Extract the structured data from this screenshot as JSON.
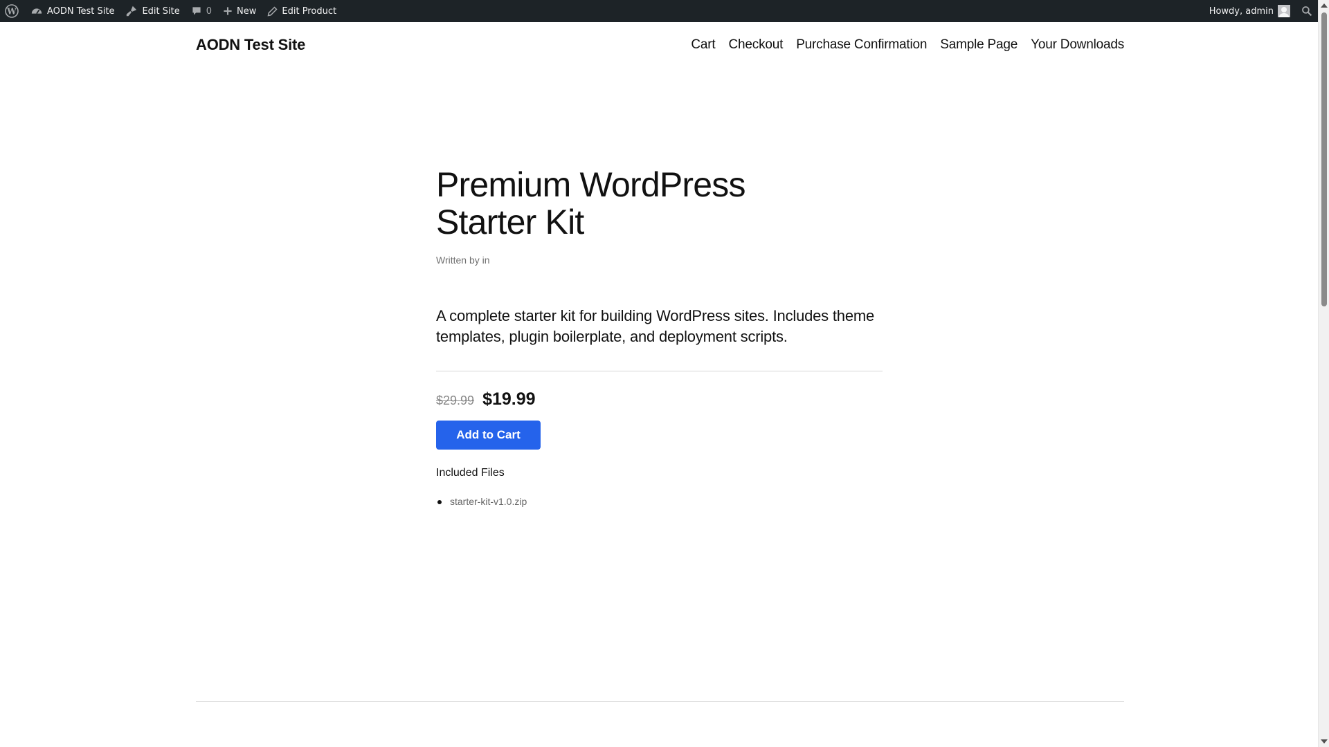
{
  "adminbar": {
    "site_name": "AODN Test Site",
    "edit_site": "Edit Site",
    "comments_count": "0",
    "new_label": "New",
    "edit_product": "Edit Product",
    "greeting": "Howdy, admin"
  },
  "site": {
    "title": "AODN Test Site",
    "nav": [
      "Cart",
      "Checkout",
      "Purchase Confirmation",
      "Sample Page",
      "Your Downloads"
    ]
  },
  "product": {
    "title_line1": "Premium WordPress",
    "title_line2": "Starter Kit",
    "byline": "Written by in",
    "description": "A complete starter kit for building WordPress sites. Includes theme templates, plugin boilerplate, and deployment scripts.",
    "old_price": "$29.99",
    "new_price": "$19.99",
    "add_to_cart": "Add to Cart",
    "files_heading": "Included Files",
    "files": [
      "starter-kit-v1.0.zip"
    ]
  },
  "colors": {
    "adminbar_bg": "#1d2327",
    "button_bg": "#2563eb"
  }
}
